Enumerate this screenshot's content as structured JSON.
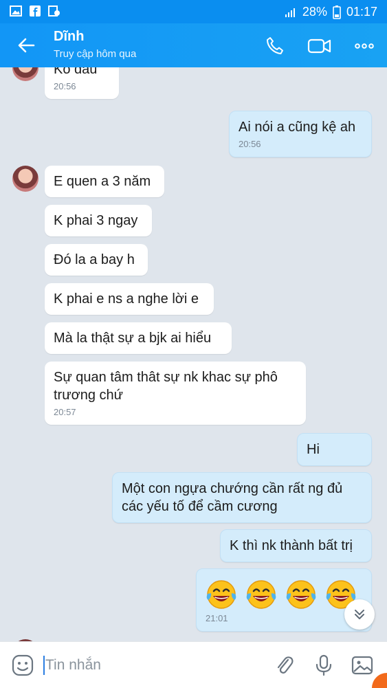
{
  "status_bar": {
    "battery": "28%",
    "time": "01:17"
  },
  "header": {
    "title": "Dĩnh",
    "subtitle": "Truy cập hôm qua"
  },
  "messages": [
    {
      "side": "in",
      "text": "Ko đâu",
      "time": "20:56"
    },
    {
      "side": "out",
      "text": "Ai nói a cũng kệ ah",
      "time": "20:56"
    },
    {
      "side": "in",
      "text": "E quen a 3 năm"
    },
    {
      "side": "in",
      "text": "K phai 3 ngay"
    },
    {
      "side": "in",
      "text": "Đó la a bay h"
    },
    {
      "side": "in",
      "text": "K phai e ns a nghe lời e"
    },
    {
      "side": "in",
      "text": "Mà la thật sự a bjk ai hiểu"
    },
    {
      "side": "in",
      "text": "Sự quan tâm thât sự nk khac sự phô trương chứ",
      "time": "20:57"
    },
    {
      "side": "out",
      "text": "Hi"
    },
    {
      "side": "out",
      "text": "Một con ngựa chướng cần rất ng đủ các yếu tố để cầm cương"
    },
    {
      "side": "out",
      "text": "K thì nk thành bất trị"
    },
    {
      "side": "out",
      "emoji": [
        "face-with-tears-of-joy",
        "face-with-tears-of-joy",
        "face-with-tears-of-joy",
        "face-with-tears-of-joy"
      ],
      "time": "21:01"
    }
  ],
  "input": {
    "placeholder": "Tin nhắn"
  },
  "icons": {
    "back": "arrow-left-icon",
    "call": "phone-icon",
    "video": "video-camera-icon",
    "more": "more-dots-icon",
    "sticker": "sticker-face-icon",
    "attach": "paperclip-icon",
    "voice": "microphone-icon",
    "image": "image-icon",
    "scroll": "chevron-double-down-icon"
  },
  "colors": {
    "header": "#1296f6",
    "outgoing_bubble": "#d4ecfb",
    "incoming_bubble": "#ffffff",
    "background": "#dfe5ec"
  }
}
